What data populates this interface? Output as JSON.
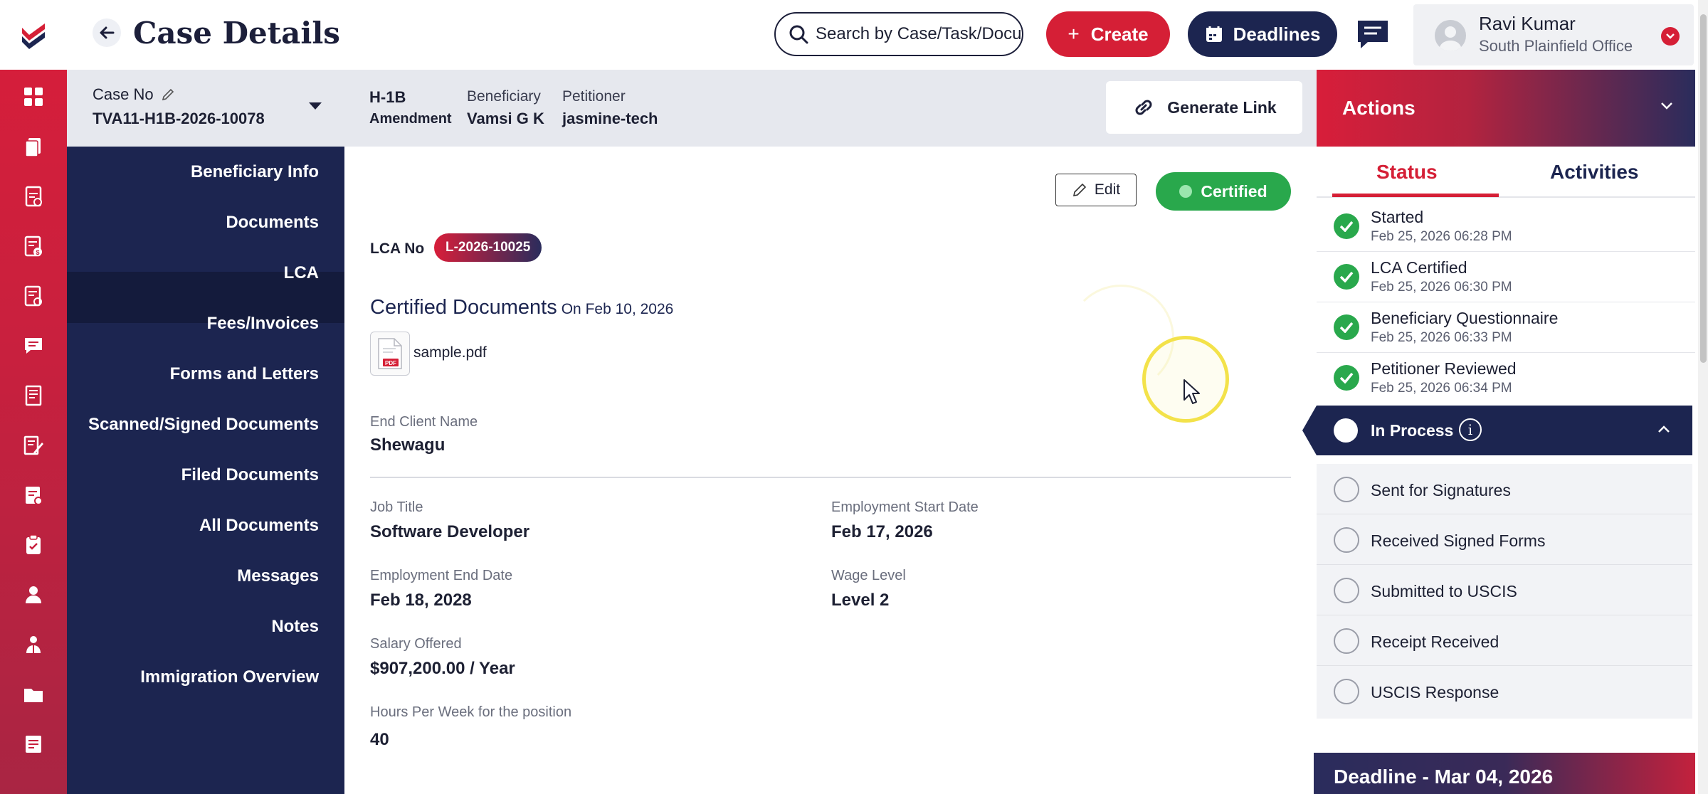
{
  "header": {
    "title": "Case Details",
    "search_placeholder": "Search by Case/Task/Document",
    "create_label": "Create",
    "deadlines_label": "Deadlines",
    "user_name": "Ravi Kumar",
    "user_office": "South Plainfield Office"
  },
  "case_bar": {
    "case_no_label": "Case No",
    "case_no_value": "TVA11-H1B-2026-10078",
    "visa_type": "H-1B",
    "visa_subtype": "Amendment",
    "beneficiary_label": "Beneficiary",
    "beneficiary_value": "Vamsi G K",
    "petitioner_label": "Petitioner",
    "petitioner_value": "jasmine-tech",
    "generate_link_label": "Generate Link"
  },
  "sections": [
    {
      "label": "Beneficiary Info"
    },
    {
      "label": "Documents"
    },
    {
      "label": "LCA",
      "active": true
    },
    {
      "label": "Fees/Invoices"
    },
    {
      "label": "Forms and Letters"
    },
    {
      "label": "Scanned/Signed Documents"
    },
    {
      "label": "Filed Documents"
    },
    {
      "label": "All Documents"
    },
    {
      "label": "Messages"
    },
    {
      "label": "Notes"
    },
    {
      "label": "Immigration Overview"
    }
  ],
  "lca": {
    "edit_label": "Edit",
    "status_label": "Certified",
    "lca_no_label": "LCA No",
    "lca_no_value": "L-2026-10025",
    "certified_docs_title": "Certified Documents",
    "certified_docs_date": "On Feb 10, 2026",
    "file_name": "sample.pdf",
    "file_icon_text": "PDF",
    "fields": {
      "end_client_label": "End Client Name",
      "end_client_value": "Shewagu",
      "job_title_label": "Job Title",
      "job_title_value": "Software Developer",
      "start_date_label": "Employment Start Date",
      "start_date_value": "Feb 17, 2026",
      "end_date_label": "Employment End Date",
      "end_date_value": "Feb 18, 2028",
      "wage_level_label": "Wage Level",
      "wage_level_value": "Level 2",
      "salary_label": "Salary Offered",
      "salary_value": "$907,200.00 / Year",
      "hours_label": "Hours Per Week for the position",
      "hours_value": "40"
    }
  },
  "actions": {
    "title": "Actions",
    "tab_status": "Status",
    "tab_activities": "Activities",
    "completed": [
      {
        "title": "Started",
        "date": "Feb 25, 2026 06:28 PM"
      },
      {
        "title": "LCA Certified",
        "date": "Feb 25, 2026 06:30 PM"
      },
      {
        "title": "Beneficiary Questionnaire",
        "date": "Feb 25, 2026 06:33 PM"
      },
      {
        "title": "Petitioner Reviewed",
        "date": "Feb 25, 2026 06:34 PM"
      }
    ],
    "in_process_label": "In Process",
    "in_process_steps": [
      {
        "label": "Sent for Signatures"
      },
      {
        "label": "Received Signed Forms"
      },
      {
        "label": "Submitted to USCIS"
      },
      {
        "label": "Receipt Received"
      },
      {
        "label": "USCIS Response"
      }
    ],
    "deadline_label": "Deadline - Mar 04, 2026"
  },
  "colors": {
    "brand_red": "#d51f36",
    "navy": "#1c2550",
    "success_green": "#29a84c"
  },
  "icons": {
    "rail": [
      "dashboard-icon",
      "cases-icon",
      "tasks-icon",
      "invoice-icon",
      "reports-icon",
      "messages-icon",
      "notes-icon",
      "forms-icon",
      "lca-icon",
      "clipboard-icon",
      "beneficiary-icon",
      "petitioner-icon",
      "folder-icon",
      "document-icon"
    ]
  }
}
